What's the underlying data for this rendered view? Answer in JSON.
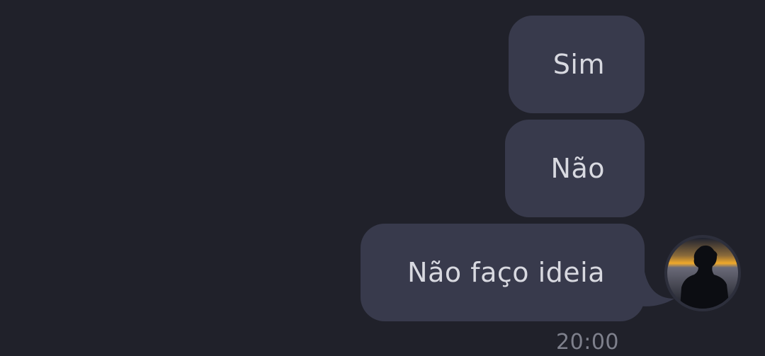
{
  "messages": [
    {
      "text": "Sim"
    },
    {
      "text": "Não"
    },
    {
      "text": "Não faço ideia"
    }
  ],
  "timestamp": "20:00",
  "colors": {
    "background": "#20212a",
    "bubble": "#383a4c",
    "text": "#d8d9e0",
    "timestamp": "#7e808c"
  }
}
